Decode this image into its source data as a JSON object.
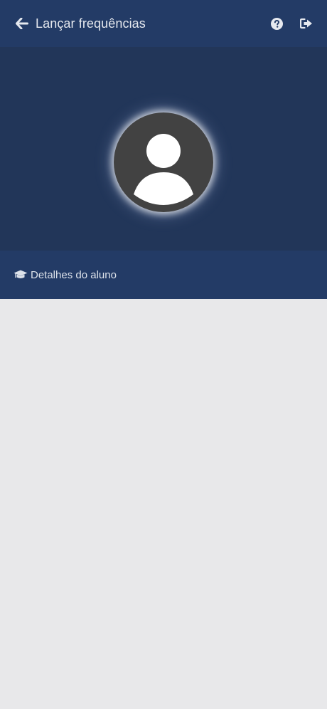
{
  "header": {
    "title": "Lançar frequências",
    "back_icon": "arrow-left-icon",
    "help_icon": "question-circle-icon",
    "logout_icon": "sign-out-icon"
  },
  "profile": {
    "avatar_icon": "user-avatar-icon"
  },
  "section": {
    "icon": "graduation-cap-icon",
    "label": "Detalhes do aluno"
  },
  "colors": {
    "header_bg": "#233b66",
    "profile_bg": "#223659",
    "avatar_bg": "#424242",
    "content_bg": "#e8e8ea",
    "text_light": "#e6e9ef"
  }
}
